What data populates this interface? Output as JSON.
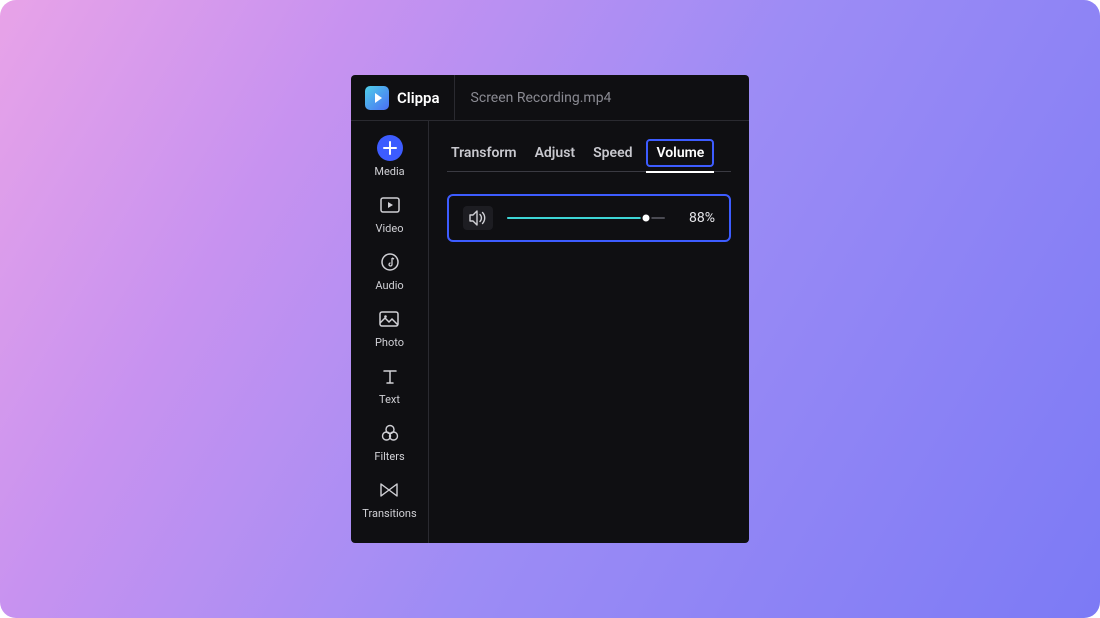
{
  "app": {
    "name": "Clippa",
    "filename": "Screen Recording.mp4"
  },
  "sidebar": {
    "items": [
      {
        "label": "Media",
        "icon": "plus",
        "active": true
      },
      {
        "label": "Video",
        "icon": "video",
        "active": false
      },
      {
        "label": "Audio",
        "icon": "audio",
        "active": false
      },
      {
        "label": "Photo",
        "icon": "photo",
        "active": false
      },
      {
        "label": "Text",
        "icon": "text",
        "active": false
      },
      {
        "label": "Filters",
        "icon": "filters",
        "active": false
      },
      {
        "label": "Transitions",
        "icon": "transitions",
        "active": false
      }
    ]
  },
  "tabs": {
    "items": [
      {
        "label": "Transform",
        "active": false
      },
      {
        "label": "Adjust",
        "active": false
      },
      {
        "label": "Speed",
        "active": false
      },
      {
        "label": "Volume",
        "active": true
      }
    ]
  },
  "volume": {
    "percent": 88,
    "display": "88%"
  }
}
